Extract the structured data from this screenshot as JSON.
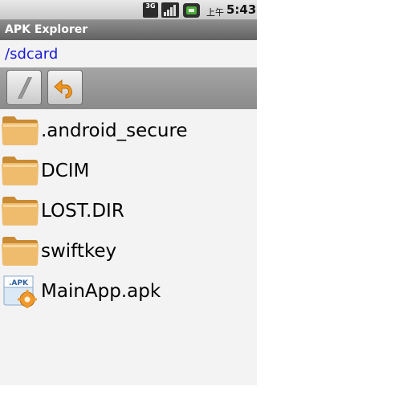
{
  "status_bar": {
    "network": "3G",
    "time_prefix": "上午",
    "time": "5:43"
  },
  "app": {
    "title": "APK Explorer"
  },
  "path": "/sdcard",
  "toolbar": {
    "buttons": [
      {
        "name": "root",
        "icon": "slash-icon"
      },
      {
        "name": "up",
        "icon": "back-arrow-icon"
      }
    ]
  },
  "files": [
    {
      "name": ".android_secure",
      "type": "folder"
    },
    {
      "name": "DCIM",
      "type": "folder"
    },
    {
      "name": "LOST.DIR",
      "type": "folder"
    },
    {
      "name": "swiftkey",
      "type": "folder"
    },
    {
      "name": "MainApp.apk",
      "type": "apk",
      "badge": ".APK"
    }
  ],
  "colors": {
    "path_text": "#1a1ad6",
    "title_bar": "#707070",
    "folder": "#e0a84f"
  }
}
